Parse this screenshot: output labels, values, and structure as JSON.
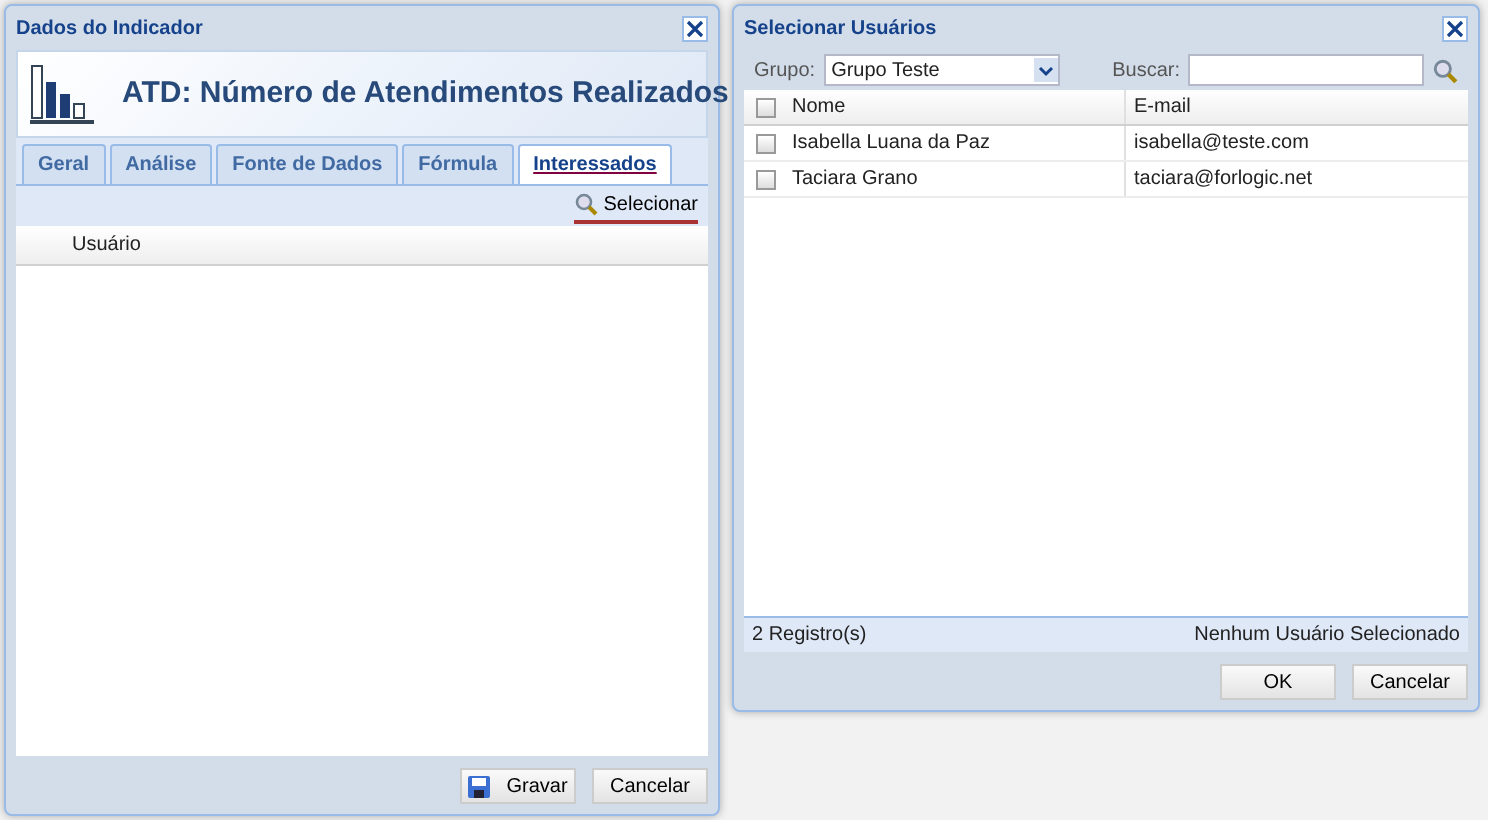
{
  "indicator_window": {
    "title": "Dados do Indicador",
    "heading": "ATD: Número de Atendimentos Realizados",
    "tabs": [
      {
        "label": "Geral",
        "selected": false
      },
      {
        "label": "Análise",
        "selected": false
      },
      {
        "label": "Fonte de Dados",
        "selected": false
      },
      {
        "label": "Fórmula",
        "selected": false
      },
      {
        "label": "Interessados",
        "selected": true
      }
    ],
    "toolbar_button": "Selecionar",
    "table": {
      "columns": [
        "Usuário"
      ]
    },
    "buttons": [
      {
        "label": "Gravar",
        "kind": "save"
      },
      {
        "label": "Cancelar",
        "kind": "plain"
      }
    ]
  },
  "users_window": {
    "title": "Selecionar Usuários",
    "group_label": "Grupo:",
    "group_value": "Grupo Teste",
    "search_label": "Buscar:",
    "table": {
      "columns": [
        "Nome",
        "E-mail"
      ],
      "all_checked": false,
      "rows": [
        {
          "name": "Isabella Luana da Paz",
          "email": "isabella@teste.com",
          "checked": false
        },
        {
          "name": "Taciara Grano",
          "email": "taciara@forlogic.net",
          "checked": false
        }
      ]
    },
    "status_left": "2 Registro(s)",
    "status_right": "Nenhum Usuário Selecionado",
    "buttons": [
      {
        "label": "OK"
      },
      {
        "label": "Cancelar"
      }
    ]
  }
}
